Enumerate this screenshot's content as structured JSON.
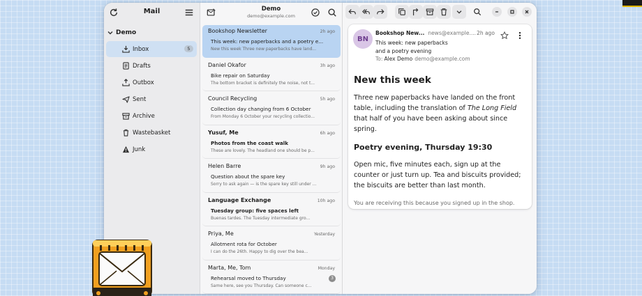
{
  "sidebar": {
    "title": "Mail",
    "account": "Demo",
    "folders": [
      {
        "label": "Inbox",
        "count": "5",
        "icon": "inbox-icon"
      },
      {
        "label": "Drafts",
        "icon": "drafts-icon"
      },
      {
        "label": "Outbox",
        "icon": "outbox-icon"
      },
      {
        "label": "Sent",
        "icon": "sent-icon"
      },
      {
        "label": "Archive",
        "icon": "archive-icon"
      },
      {
        "label": "Wastebasket",
        "icon": "trash-icon"
      },
      {
        "label": "Junk",
        "icon": "junk-icon"
      }
    ]
  },
  "list": {
    "account_name": "Demo",
    "account_email": "demo@example.com",
    "messages": [
      {
        "sender": "Bookshop Newsletter",
        "time": "2h ago",
        "subject": "This week: new paperbacks and a poetry e...",
        "preview": "New this week Three new paperbacks have land..."
      },
      {
        "sender": "Daniel Okafor",
        "time": "3h ago",
        "subject": "Bike repair on Saturday",
        "preview": "The bottom bracket is definitely the noise, not t..."
      },
      {
        "sender": "Council Recycling",
        "time": "5h ago",
        "subject": "Collection day changing from 6 October",
        "preview": "From Monday 6 October your recycling collectio..."
      },
      {
        "sender": "Yusuf, Me",
        "time": "6h ago",
        "subject": "Photos from the coast walk",
        "preview": "These are lovely. The headland one should be p..."
      },
      {
        "sender": "Helen Barre",
        "time": "9h ago",
        "subject": "Question about the spare key",
        "preview": "Sorry to ask again — is the spare key still under ..."
      },
      {
        "sender": "Language Exchange",
        "time": "10h ago",
        "subject": "Tuesday group: five spaces left",
        "preview": "Buenas tardes. The Tuesday intermediate gro..."
      },
      {
        "sender": "Priya, Me",
        "time": "Yesterday",
        "subject": "Allotment rota for October",
        "preview": "I can do the 26th. Happy to dig over the bea..."
      },
      {
        "sender": "Marta, Me, Tom",
        "time": "Monday",
        "subject": "Rehearsal moved to Thursday",
        "preview": "Same here, see you Thursday. Can someone c...",
        "thread_count": "3"
      }
    ]
  },
  "reader": {
    "avatar_initials": "BN",
    "from_name": "Bookshop New...",
    "from_address": "news@example....",
    "time": "2h ago",
    "subject_line1": "This week: new paperbacks",
    "subject_line2": "and a poetry evening",
    "to_label": "To:",
    "to_name": "Alex Demo",
    "to_address": "demo@example.com",
    "body": {
      "heading1": "New this week",
      "para1_before": "Three new paperbacks have landed on the front table, including the translation of ",
      "para1_title": "The Long Field",
      "para1_after": " that half of you have been asking about since spring.",
      "heading2": "Poetry evening, Thursday 19:30",
      "para2": "Open mic, five minutes each, sign up at the counter or just turn up. Tea and biscuits provided; the biscuits are better than last month.",
      "footer": "You are receiving this because you signed up in the shop."
    }
  },
  "colors": {
    "accent": "#b9d4f2",
    "active_folder": "#cfe0f3",
    "avatar_bg": "#d9c6e6",
    "avatar_fg": "#6f3f8f",
    "app_icon": "#f0a020"
  }
}
